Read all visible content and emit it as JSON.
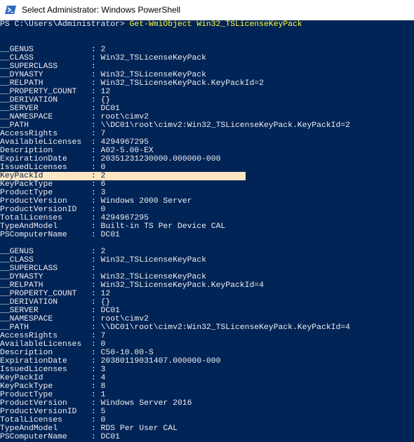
{
  "window": {
    "title": "Select Administrator: Windows PowerShell",
    "icon": "powershell-icon"
  },
  "console": {
    "prompt": "PS C:\\Users\\Administrator> ",
    "command": "Get-WmiObject Win32_TSLicenseKeyPack",
    "highlight_color": "#fce6c3",
    "background_color": "#012456",
    "command_color": "#fbfc3a",
    "text_color": "#eeedf0",
    "lines": [
      {
        "text": ""
      },
      {
        "text": ""
      },
      {
        "text": "__GENUS            : 2"
      },
      {
        "text": "__CLASS            : Win32_TSLicenseKeyPack"
      },
      {
        "text": "__SUPERCLASS       :"
      },
      {
        "text": "__DYNASTY          : Win32_TSLicenseKeyPack"
      },
      {
        "text": "__RELPATH          : Win32_TSLicenseKeyPack.KeyPackId=2"
      },
      {
        "text": "__PROPERTY_COUNT   : 12"
      },
      {
        "text": "__DERIVATION       : {}"
      },
      {
        "text": "__SERVER           : DC01"
      },
      {
        "text": "__NAMESPACE        : root\\cimv2"
      },
      {
        "text": "__PATH             : \\\\DC01\\root\\cimv2:Win32_TSLicenseKeyPack.KeyPackId=2"
      },
      {
        "text": "AccessRights       : 7"
      },
      {
        "text": "AvailableLicenses  : 4294967295"
      },
      {
        "text": "Description        : A02-5.00-EX"
      },
      {
        "text": "ExpirationDate     : 20351231230000.000000-000"
      },
      {
        "text": "IssuedLicenses     : 0"
      },
      {
        "text": "KeyPackId          : 2",
        "highlight": true
      },
      {
        "text": "KeyPackType        : 6"
      },
      {
        "text": "ProductType        : 3"
      },
      {
        "text": "ProductVersion     : Windows 2000 Server"
      },
      {
        "text": "ProductVersionID   : 0"
      },
      {
        "text": "TotalLicenses      : 4294967295"
      },
      {
        "text": "TypeAndModel       : Built-in TS Per Device CAL"
      },
      {
        "text": "PSComputerName     : DC01"
      },
      {
        "text": ""
      },
      {
        "text": "__GENUS            : 2"
      },
      {
        "text": "__CLASS            : Win32_TSLicenseKeyPack"
      },
      {
        "text": "__SUPERCLASS       :"
      },
      {
        "text": "__DYNASTY          : Win32_TSLicenseKeyPack"
      },
      {
        "text": "__RELPATH          : Win32_TSLicenseKeyPack.KeyPackId=4"
      },
      {
        "text": "__PROPERTY_COUNT   : 12"
      },
      {
        "text": "__DERIVATION       : {}"
      },
      {
        "text": "__SERVER           : DC01"
      },
      {
        "text": "__NAMESPACE        : root\\cimv2"
      },
      {
        "text": "__PATH             : \\\\DC01\\root\\cimv2:Win32_TSLicenseKeyPack.KeyPackId=4"
      },
      {
        "text": "AccessRights       : 7"
      },
      {
        "text": "AvailableLicenses  : 0"
      },
      {
        "text": "Description        : C50-10.00-S"
      },
      {
        "text": "ExpirationDate     : 20380119031407.000000-000"
      },
      {
        "text": "IssuedLicenses     : 3"
      },
      {
        "text": "KeyPackId          : 4"
      },
      {
        "text": "KeyPackType        : 8"
      },
      {
        "text": "ProductType        : 1"
      },
      {
        "text": "ProductVersion     : Windows Server 2016"
      },
      {
        "text": "ProductVersionID   : 5"
      },
      {
        "text": "TotalLicenses      : 0"
      },
      {
        "text": "TypeAndModel       : RDS Per User CAL"
      },
      {
        "text": "PSComputerName     : DC01"
      }
    ]
  }
}
